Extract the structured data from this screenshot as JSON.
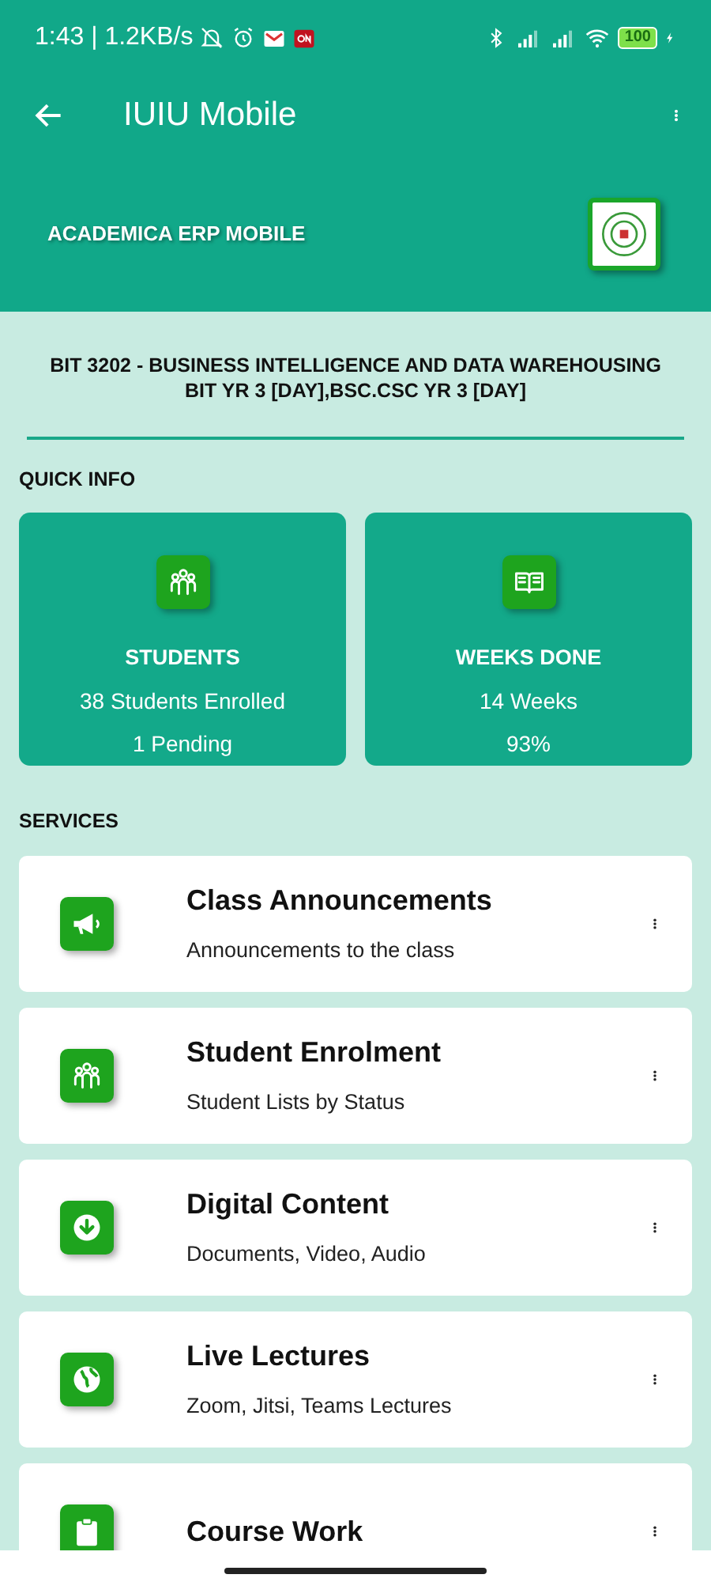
{
  "status_bar": {
    "time": "1:43 | 1.2KB/s",
    "battery": "100"
  },
  "app_bar": {
    "title": "IUIU Mobile"
  },
  "banner": {
    "label": "ACADEMICA ERP MOBILE"
  },
  "course": {
    "title": "BIT 3202 -  BUSINESS INTELLIGENCE AND DATA WAREHOUSING",
    "groups": "BIT YR 3 [DAY],BSC.CSC YR 3 [DAY]"
  },
  "quick_info": {
    "heading": "QUICK INFO",
    "tiles": [
      {
        "kind": "people",
        "title": "STUDENTS",
        "lines": [
          "38 Students Enrolled",
          "1  Pending"
        ]
      },
      {
        "kind": "book",
        "title": "WEEKS DONE",
        "lines": [
          "14 Weeks",
          "93%"
        ]
      }
    ]
  },
  "services": {
    "heading": "SERVICES",
    "items": [
      {
        "kind": "megaphone",
        "title": "Class Announcements",
        "subtitle": "Announcements to the class"
      },
      {
        "kind": "people",
        "title": "Student Enrolment",
        "subtitle": "Student Lists by Status"
      },
      {
        "kind": "download",
        "title": "Digital Content",
        "subtitle": "Documents, Video, Audio"
      },
      {
        "kind": "globe",
        "title": "Live Lectures",
        "subtitle": "Zoom, Jitsi, Teams Lectures"
      },
      {
        "kind": "clipboard",
        "title": "Course Work"
      }
    ]
  }
}
